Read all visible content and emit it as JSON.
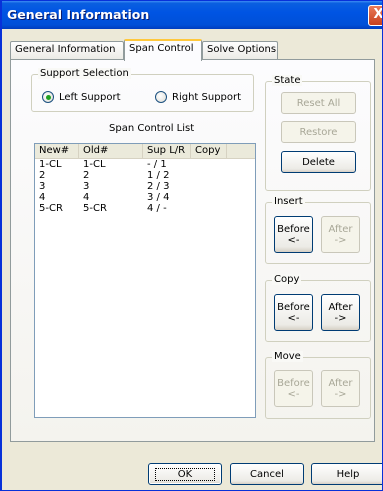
{
  "window": {
    "title": "General Information",
    "close_glyph": "X"
  },
  "tabs": [
    {
      "label": "General Information"
    },
    {
      "label": "Span Control"
    },
    {
      "label": "Solve Options"
    }
  ],
  "support_selection": {
    "title": "Support Selection",
    "options": [
      "Left Support",
      "Right Support"
    ],
    "selected": "Left Support"
  },
  "span_list": {
    "caption": "Span Control List",
    "columns": [
      "New#",
      "Old#",
      "Sup L/R",
      "Copy"
    ],
    "rows": [
      {
        "new": "1-CL",
        "old": "1-CL",
        "sup": "- / 1",
        "copy": ""
      },
      {
        "new": "2",
        "old": "2",
        "sup": "1 / 2",
        "copy": ""
      },
      {
        "new": "3",
        "old": "3",
        "sup": "2 / 3",
        "copy": ""
      },
      {
        "new": "4",
        "old": "4",
        "sup": "3 / 4",
        "copy": ""
      },
      {
        "new": "5-CR",
        "old": "5-CR",
        "sup": "4 / -",
        "copy": ""
      }
    ]
  },
  "state": {
    "title": "State",
    "reset_all": "Reset All",
    "restore": "Restore",
    "delete": "Delete"
  },
  "insert": {
    "title": "Insert",
    "before": "Before",
    "before_arrow": "<-",
    "after": "After",
    "after_arrow": "->"
  },
  "copy": {
    "title": "Copy",
    "before": "Before",
    "before_arrow": "<-",
    "after": "After",
    "after_arrow": "->"
  },
  "move": {
    "title": "Move",
    "before": "Before",
    "before_arrow": "<-",
    "after": "After",
    "after_arrow": "->"
  },
  "footer": {
    "ok": "OK",
    "cancel": "Cancel",
    "help": "Help"
  }
}
